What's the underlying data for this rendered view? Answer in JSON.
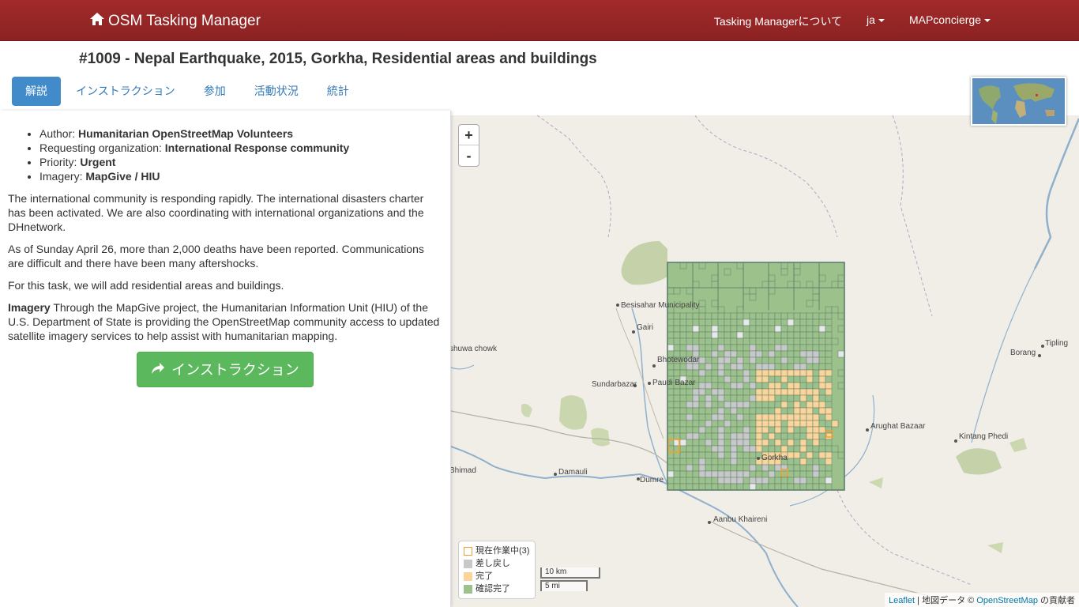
{
  "navbar": {
    "brand": "OSM Tasking Manager",
    "about": "Tasking Managerについて",
    "language": "ja",
    "user": "MAPconcierge"
  },
  "page_title": "#1009 - Nepal Earthquake, 2015, Gorkha, Residential areas and buildings",
  "tabs": [
    "解説",
    "インストラクション",
    "参加",
    "活動状況",
    "統計"
  ],
  "description": {
    "meta": [
      {
        "label": "Author: ",
        "value": "Humanitarian OpenStreetMap Volunteers"
      },
      {
        "label": "Requesting organization: ",
        "value": "International Response community"
      },
      {
        "label": "Priority: ",
        "value": "Urgent"
      },
      {
        "label": "Imagery: ",
        "value": "MapGive / HIU"
      }
    ],
    "para1": "The international community is responding rapidly. The international disasters charter has been activated. We are also coordinating with international organizations and the DHnetwork.",
    "para2": "As of Sunday April 26, more than 2,000 deaths have been reported. Communications are difficult and there have been many aftershocks.",
    "para3": "For this task, we will add residential areas and buildings.",
    "para4_bold": "Imagery",
    "para4": " Through the MapGive project, the Humanitarian Information Unit (HIU) of the U.S. Department of State is providing the OpenStreetMap community access to updated satellite imagery services to help assist with humanitarian mapping.",
    "button": "インストラクション"
  },
  "map": {
    "zoom_in": "+",
    "zoom_out": "-",
    "places": [
      "Besisahar Municipality",
      "Gairi",
      "Bhotewodar",
      "Sundarbazar",
      "Paudi Bazar",
      "Gorkha",
      "Damauli",
      "Dumre",
      "Bhimad",
      "Aanbu Khaireni",
      "Arughat Bazaar",
      "Kintang Phedi",
      "Borang",
      "Tipling",
      "shuwa chowk"
    ],
    "legend": [
      {
        "label": "現在作業中(3)",
        "color": "#f0a030",
        "outline": true
      },
      {
        "label": "差し戻し",
        "color": "#c8c8c8",
        "outline": false
      },
      {
        "label": "完了",
        "color": "#fbd49a",
        "outline": false
      },
      {
        "label": "確認完了",
        "color": "#9dc18a",
        "outline": false
      }
    ],
    "scale_km": "10 km",
    "scale_mi": "5 mi",
    "attribution_leaflet": "Leaflet",
    "attribution_mid": " | 地図データ © ",
    "attribution_osm": "OpenStreetMap",
    "attribution_end": " の貢献者"
  }
}
